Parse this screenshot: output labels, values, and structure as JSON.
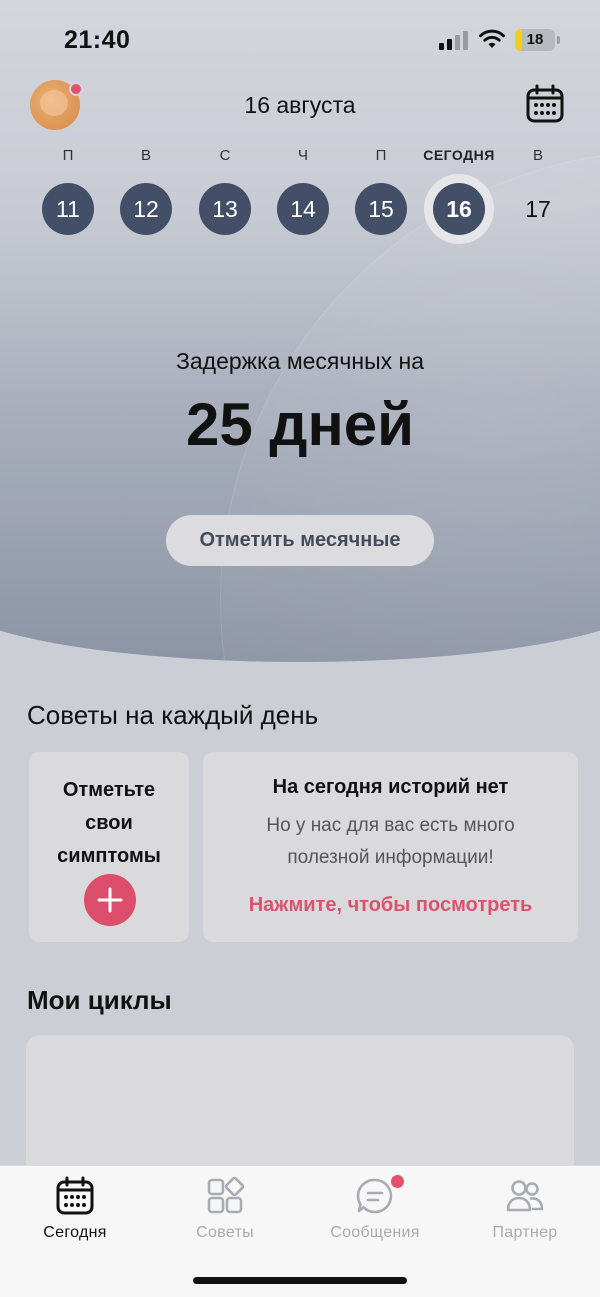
{
  "status_bar": {
    "time": "21:40",
    "battery": "18",
    "battery_level_percent": 18,
    "battery_color": "#f5cc17"
  },
  "header": {
    "date": "16 августа",
    "calendar_icon": "calendar-icon",
    "notification_color": "#e4506e"
  },
  "week": [
    {
      "label": "П",
      "day": "11"
    },
    {
      "label": "В",
      "day": "12"
    },
    {
      "label": "С",
      "day": "13"
    },
    {
      "label": "Ч",
      "day": "14"
    },
    {
      "label": "П",
      "day": "15"
    },
    {
      "label": "СЕГОДНЯ",
      "day": "16"
    },
    {
      "label": "В",
      "day": "17"
    }
  ],
  "hero": {
    "delay_text": "Задержка месячных на",
    "delay_days": "25 дней",
    "mark_button": "Отметить месячные"
  },
  "tips": {
    "title": "Советы на каждый день",
    "symptoms_card": "Отметьте свои симптомы",
    "stories_title": "На сегодня историй нет",
    "stories_subtitle": "Но у нас для вас есть много полезной информации!",
    "stories_link": "Нажмите, чтобы посмотреть",
    "accent_color": "#dd4d6c"
  },
  "cycles": {
    "title": "Мои циклы"
  },
  "tabbar": {
    "items": [
      {
        "label": "Сегодня",
        "icon": "calendar-icon",
        "active": true
      },
      {
        "label": "Советы",
        "icon": "grid-icon",
        "active": false
      },
      {
        "label": "Сообщения",
        "icon": "chat-icon",
        "active": false
      },
      {
        "label": "Партнер",
        "icon": "people-icon",
        "active": false
      }
    ]
  }
}
